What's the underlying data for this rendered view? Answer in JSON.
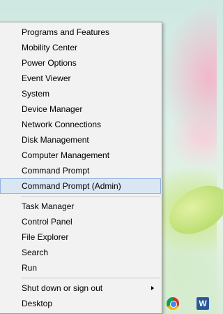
{
  "menu": {
    "items": [
      {
        "label": "Programs and Features"
      },
      {
        "label": "Mobility Center"
      },
      {
        "label": "Power Options"
      },
      {
        "label": "Event Viewer"
      },
      {
        "label": "System"
      },
      {
        "label": "Device Manager"
      },
      {
        "label": "Network Connections"
      },
      {
        "label": "Disk Management"
      },
      {
        "label": "Computer Management"
      },
      {
        "label": "Command Prompt"
      },
      {
        "label": "Command Prompt (Admin)",
        "selected": true
      },
      {
        "label": "Task Manager"
      },
      {
        "label": "Control Panel"
      },
      {
        "label": "File Explorer"
      },
      {
        "label": "Search"
      },
      {
        "label": "Run"
      },
      {
        "label": "Shut down or sign out",
        "has_submenu": true
      },
      {
        "label": "Desktop"
      }
    ]
  },
  "taskbar": {
    "icons": [
      "browser-app-icon",
      "word-app-icon"
    ],
    "word_glyph": "W"
  },
  "colors": {
    "menu_bg": "#f2f2f2",
    "selection_bg": "#dbe6f4",
    "selection_border": "#8fb1e0",
    "word_blue": "#2b579a"
  }
}
